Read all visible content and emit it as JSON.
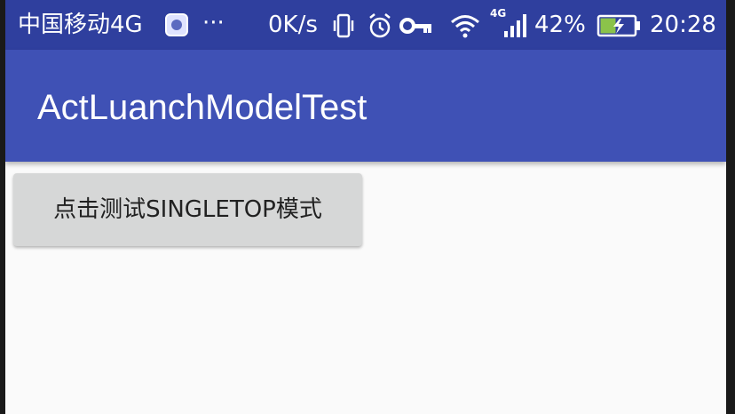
{
  "status_bar": {
    "carrier": "中国移动4G",
    "more": "···",
    "speed": "0K/s",
    "net_badge": "4G",
    "battery_percent": "42%",
    "time": "20:28",
    "icons": [
      "app-badge-icon",
      "vibrate-icon",
      "alarm-icon",
      "key-icon",
      "wifi-icon",
      "signal-icon",
      "battery-charging-icon"
    ]
  },
  "app_bar": {
    "title": "ActLuanchModelTest"
  },
  "main": {
    "button_label": "点击测试SINGLETOP模式"
  },
  "colors": {
    "status_bar": "#2f3f9e",
    "primary": "#3f51b5",
    "background": "#fafafa",
    "button": "#d6d7d7",
    "battery_fill": "#8bc34a"
  }
}
